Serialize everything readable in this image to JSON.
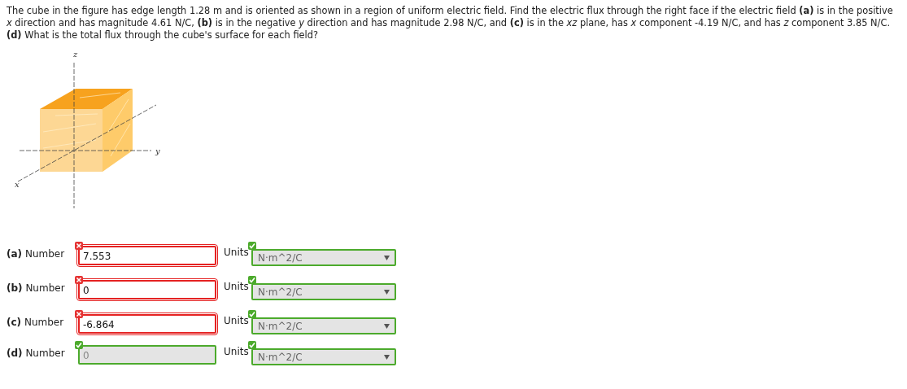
{
  "question": "The cube in the figure has edge length 1.28 m and is oriented as shown in a region of uniform electric field. Find the electric flux through the right face if the electric field **(a)** is in the positive *x* direction and has magnitude 4.61 N/C, **(b)** is in the negative *y* direction and has magnitude 2.98 N/C, and **(c)** is in the *xz* plane, has *x* component -4.19 N/C, and has *z* component 3.85 N/C. **(d)** What is the total flux through the cube's surface for each field?",
  "figure": {
    "axis_labels": [
      "z",
      "y",
      "x"
    ]
  },
  "answers": [
    {
      "part": "(a)",
      "label": "Number",
      "value": "7.553",
      "correct": false,
      "disabled": false,
      "units_label": "Units",
      "units": "N·m^2/C",
      "units_correct": true
    },
    {
      "part": "(b)",
      "label": "Number",
      "value": "0",
      "correct": false,
      "disabled": false,
      "units_label": "Units",
      "units": "N·m^2/C",
      "units_correct": true
    },
    {
      "part": "(c)",
      "label": "Number",
      "value": "-6.864",
      "correct": false,
      "disabled": false,
      "units_label": "Units",
      "units": "N·m^2/C",
      "units_correct": true
    },
    {
      "part": "(d)",
      "label": "Number",
      "value": "0",
      "correct": true,
      "disabled": true,
      "units_label": "Units",
      "units": "N·m^2/C",
      "units_correct": true
    }
  ]
}
